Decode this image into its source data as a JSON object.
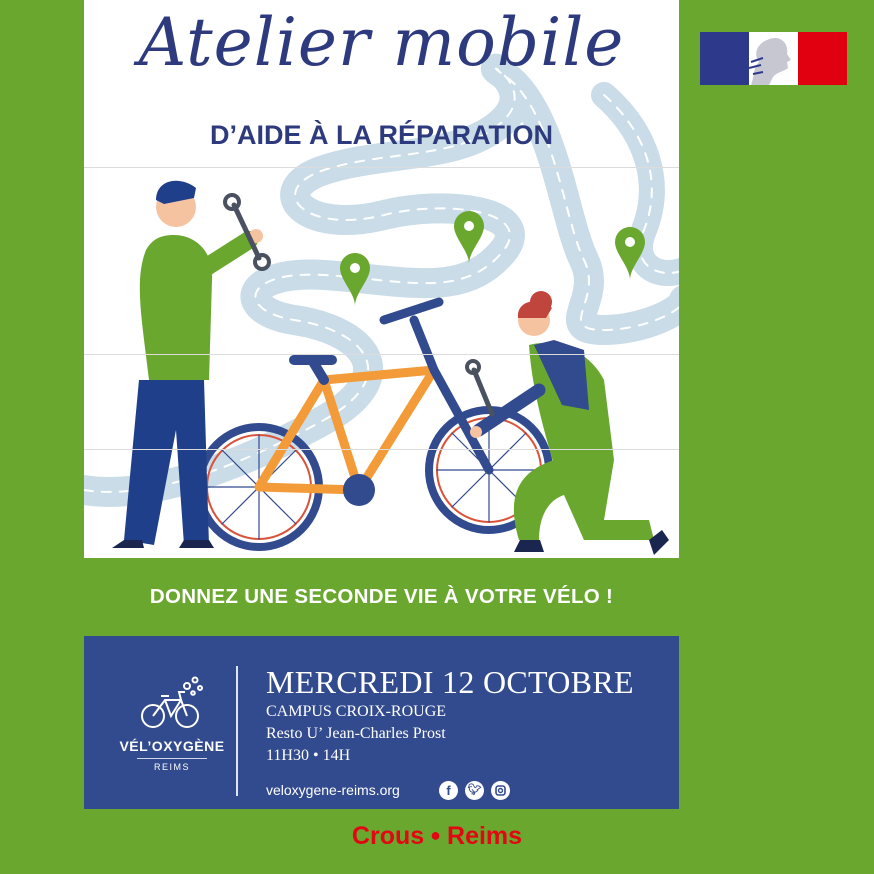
{
  "poster": {
    "title": "Atelier mobile",
    "subtitle": "D’AIDE À LA RÉPARATION",
    "slogan": "DONNEZ UNE SECONDE VIE À VOTRE VÉLO !"
  },
  "event": {
    "date": "MERCREDI 12 OCTOBRE",
    "campus": "CAMPUS CROIX-ROUGE",
    "venue": "Resto U’ Jean-Charles Prost",
    "time": "11H30 • 14H"
  },
  "organizer": {
    "name": "VÉL’OXYGÈNE",
    "city": "REIMS",
    "website": "veloxygene-reims.org"
  },
  "social_icons": [
    "facebook-icon",
    "twitter-icon",
    "instagram-icon"
  ],
  "footer": {
    "left": "Crous",
    "right": "Reims"
  },
  "colors": {
    "background_green": "#6aa72f",
    "navy": "#2d3b7e",
    "info_blue": "#324a8e",
    "crous_red": "#e30613",
    "bike_orange": "#f29b38"
  }
}
